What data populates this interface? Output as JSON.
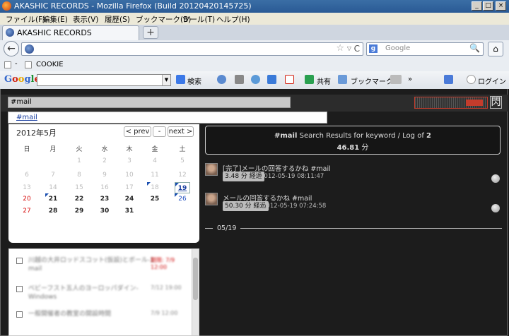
{
  "window": {
    "title": "AKASHIC RECORDS - Mozilla Firefox (Build 20120420145725)",
    "buttons": [
      "_",
      "□",
      "×"
    ]
  },
  "menu": [
    "ファイル(F)",
    "編集(E)",
    "表示(V)",
    "履歴(S)",
    "ブックマーク(B)",
    "ツール(T)",
    "ヘルプ(H)"
  ],
  "tab": {
    "label": "AKASHIC RECORDS",
    "new": "+"
  },
  "nav": {
    "back": "←",
    "url": "",
    "star": "☆",
    "dropdown": "▽",
    "reload": "C",
    "search_engine": "g",
    "search_placeholder": "Google",
    "search_icon": "🔍",
    "home": "⌂"
  },
  "bookmarks": {
    "item": "COOKIE",
    "dash": "-"
  },
  "google_toolbar": {
    "logo": [
      "G",
      "o",
      "o",
      "g",
      "l",
      "e"
    ],
    "search": "検索",
    "share": "共有",
    "bookmarks": "ブックマーク",
    "more": "»",
    "login": "ログイン"
  },
  "app": {
    "search_value": "#mail",
    "suggestion": "#mail",
    "logo_icon": "閃",
    "calendar": {
      "month": "2012年5月",
      "prev": "< prev",
      "today": "-",
      "next": "next >",
      "day_names": [
        "日",
        "月",
        "火",
        "水",
        "木",
        "金",
        "土"
      ],
      "weeks": [
        [
          "",
          "",
          "1",
          "2",
          "3",
          "4",
          "5"
        ],
        [
          "6",
          "7",
          "8",
          "9",
          "10",
          "11",
          "12"
        ],
        [
          "13",
          "14",
          "15",
          "16",
          "17",
          "18",
          "19"
        ],
        [
          "20",
          "21",
          "22",
          "23",
          "24",
          "25",
          "26"
        ],
        [
          "27",
          "28",
          "29",
          "30",
          "31",
          "",
          ""
        ]
      ]
    },
    "summary": {
      "keyword": "#mail",
      "line1_text": "Search Results for keyword / Log of",
      "count": "2",
      "line2_value": "46.81",
      "line2_unit": "分"
    },
    "results": [
      {
        "title": "[完了]メールの回答するかね #mail",
        "tag": "3.48 分 経過",
        "datetime": "2012-05-19 08:11:47"
      },
      {
        "title": "メールの回答するかね #mail",
        "tag": "50.30 分 経過",
        "datetime": "2012-05-19 07:24:58"
      }
    ],
    "divider": "05/19",
    "todos": [
      {
        "text": "川越の大井ロッドスコット(仮設)とボール-1 mail",
        "date": "期限: 7/9 12:00",
        "red": true
      },
      {
        "text": "ベビーフスト五人のヨーロッパダイン-Windows",
        "date": "7/12 19:00",
        "red": false
      },
      {
        "text": "一般開催者の教室の開設時間",
        "date": "7/9 12:00",
        "red": false
      }
    ]
  }
}
